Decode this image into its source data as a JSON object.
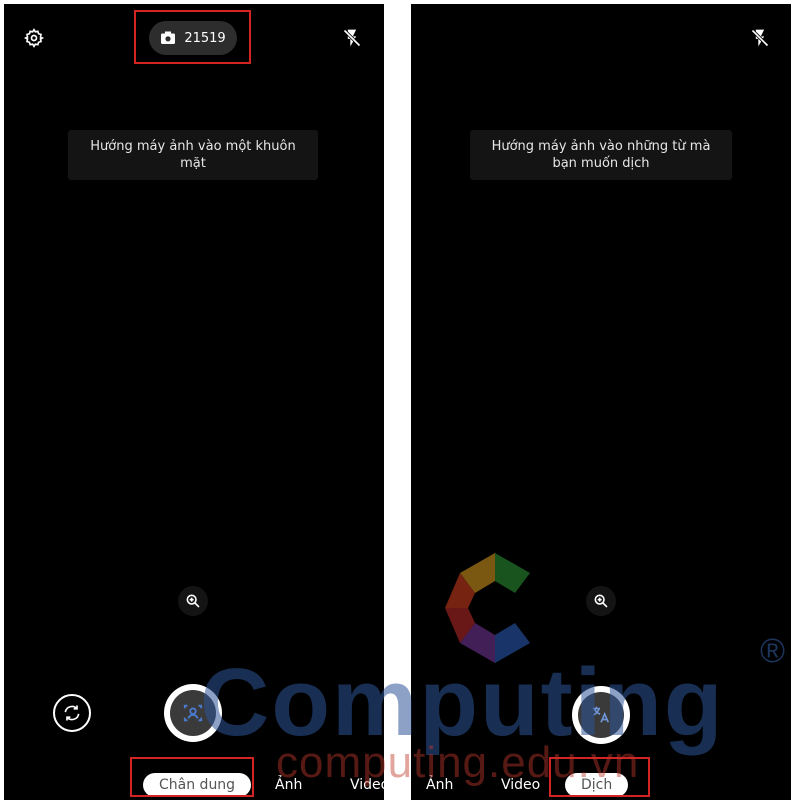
{
  "left_screen": {
    "photo_count": "21519",
    "hint": "Hướng máy ảnh vào một khuôn mặt",
    "modes": [
      "Chân dung",
      "Ảnh",
      "Video"
    ],
    "active_mode": "Chân dung"
  },
  "right_screen": {
    "hint": "Hướng máy ảnh vào những từ mà bạn muốn dịch",
    "modes": [
      "Ảnh",
      "Video",
      "Dịch"
    ],
    "active_mode": "Dịch"
  },
  "watermark": {
    "brand": "Computing",
    "registered": "®",
    "url": "computing.edu.vn"
  },
  "icons": [
    "gear-icon",
    "camera-icon",
    "flash-off-icon",
    "zoom-in-icon",
    "switch-camera-icon",
    "portrait-icon",
    "translate-icon"
  ],
  "colors": {
    "highlight": "#d32424",
    "watermark_blue": "#2f5597",
    "watermark_red": "#c0392b"
  }
}
